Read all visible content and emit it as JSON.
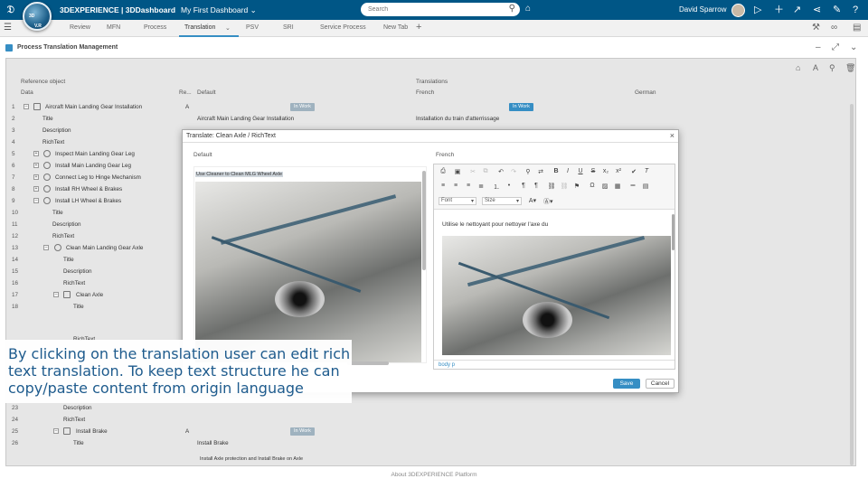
{
  "topbar": {
    "brand": "3DEXPERIENCE | 3DDashboard",
    "dashboard": "My First Dashboard",
    "search_placeholder": "Search",
    "user": "David Sparrow",
    "compass_labels": [
      "3D",
      "V.R"
    ]
  },
  "tabs": [
    {
      "label": "Review"
    },
    {
      "label": "MFN"
    },
    {
      "label": "Process"
    },
    {
      "label": "Translation"
    },
    {
      "label": "PSV"
    },
    {
      "label": "SRI"
    },
    {
      "label": "Service Process"
    },
    {
      "label": "New Tab"
    }
  ],
  "app": {
    "title": "Process Translation Management"
  },
  "grid": {
    "group_headers": {
      "reference": "Reference object",
      "translations": "Translations"
    },
    "columns": {
      "data": "Data",
      "rev": "Re...",
      "default": "Default",
      "french": "French",
      "german": "German"
    },
    "rows": [
      {
        "n": "1",
        "name": "Aircraft Main Landing Gear Installation",
        "rev": "A",
        "def_badge": "In Work",
        "fr_badge": "In Work"
      },
      {
        "n": "2",
        "name": "Title",
        "def": "Aircraft Main Landing Gear Installation",
        "fr": "Installation du train d'atterrissage"
      },
      {
        "n": "3",
        "name": "Description"
      },
      {
        "n": "4",
        "name": "RichText"
      },
      {
        "n": "5",
        "name": "Inspect Main Landing Gear Leg"
      },
      {
        "n": "6",
        "name": "Install Main Landing Gear Leg"
      },
      {
        "n": "7",
        "name": "Connect Leg to Hinge Mechanism"
      },
      {
        "n": "8",
        "name": "Install RH Wheel & Brakes"
      },
      {
        "n": "9",
        "name": "Install LH Wheel & Brakes"
      },
      {
        "n": "10",
        "name": "Title"
      },
      {
        "n": "11",
        "name": "Description"
      },
      {
        "n": "12",
        "name": "RichText"
      },
      {
        "n": "13",
        "name": "Clean Main Landing Gear Axle"
      },
      {
        "n": "14",
        "name": "Title"
      },
      {
        "n": "15",
        "name": "Description"
      },
      {
        "n": "16",
        "name": "RichText"
      },
      {
        "n": "17",
        "name": "Clean Axle"
      },
      {
        "n": "18",
        "name": "Title"
      },
      {
        "n": "",
        "name": "RichText"
      },
      {
        "n": "23",
        "name": "Description"
      },
      {
        "n": "24",
        "name": "RichText"
      },
      {
        "n": "25",
        "name": "Install Brake",
        "rev": "A",
        "def_badge": "In Work"
      },
      {
        "n": "26",
        "name": "Title",
        "def": "Install Brake"
      },
      {
        "n": "",
        "name": "",
        "def": "Install Axle protection and Install Brake on Axle"
      }
    ]
  },
  "modal": {
    "title": "Translate: Clean Axle / RichText",
    "default_label": "Default",
    "french_label": "French",
    "source_text": "Use Cleaner to Clean MLG Wheel Axle",
    "translation_text": "Utilise le nettoyant pour nettoyer l'axe du",
    "font_label": "Font",
    "size_label": "Size",
    "status_path": "body  p",
    "save": "Save",
    "cancel": "Cancel"
  },
  "caption": "By clicking on the translation user can edit rich text translation. To keep text structure he can copy/paste content from origin language",
  "footer": "About 3DEXPERIENCE Platform",
  "colors": {
    "topbar": "#005686",
    "accent": "#368ec4",
    "caption_text": "#1e5b8d"
  }
}
